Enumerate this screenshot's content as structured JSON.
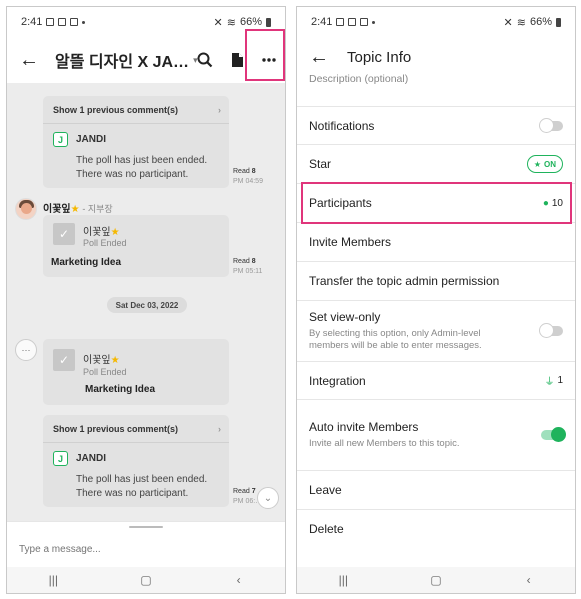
{
  "left": {
    "status": {
      "time": "2:41",
      "battery": "66%"
    },
    "header": {
      "title": "알뜰 디자인 X JA…"
    },
    "messages": {
      "comment_block_1": {
        "show_prev": "Show 1 previous comment(s)",
        "sender": "JANDI",
        "line1": "The poll has just been ended.",
        "line2": "There was no participant.",
        "read_label": "Read",
        "read_count": "8",
        "time": "PM 04:59"
      },
      "user_post": {
        "sender": "이꽃잎",
        "role": "- 지부장",
        "poll_title": "이꽃잎",
        "poll_status": "Poll Ended",
        "poll_name": "Marketing Idea",
        "read_label": "Read",
        "read_count": "8",
        "time": "PM 05:11"
      },
      "date_divider": "Sat Dec 03, 2022",
      "system_post": {
        "poll_title": "이꽃잎",
        "poll_status": "Poll Ended",
        "poll_name": "Marketing Idea"
      },
      "comment_block_2": {
        "show_prev": "Show 1 previous comment(s)",
        "sender": "JANDI",
        "line1": "The poll has just been ended.",
        "line2": "There was no participant.",
        "read_label": "Read",
        "read_count": "7",
        "time": "PM 06:…"
      }
    },
    "input": {
      "placeholder": "Type a message..."
    }
  },
  "right": {
    "status": {
      "time": "2:41",
      "battery": "66%"
    },
    "header": {
      "title": "Topic Info"
    },
    "rows": {
      "description": "Description (optional)",
      "notifications": "Notifications",
      "star": "Star",
      "star_state": "ON",
      "participants": "Participants",
      "participants_count": "10",
      "invite": "Invite Members",
      "transfer": "Transfer the topic admin permission",
      "view_only": "Set view-only",
      "view_only_desc": "By selecting this option, only Admin-level members will be able to enter messages.",
      "integration": "Integration",
      "integration_count": "1",
      "auto_invite": "Auto invite Members",
      "auto_invite_desc": "Invite all new Members to this topic.",
      "leave": "Leave",
      "delete": "Delete"
    }
  },
  "colors": {
    "accent_green": "#1fb35c",
    "highlight_pink": "#e0357b"
  }
}
